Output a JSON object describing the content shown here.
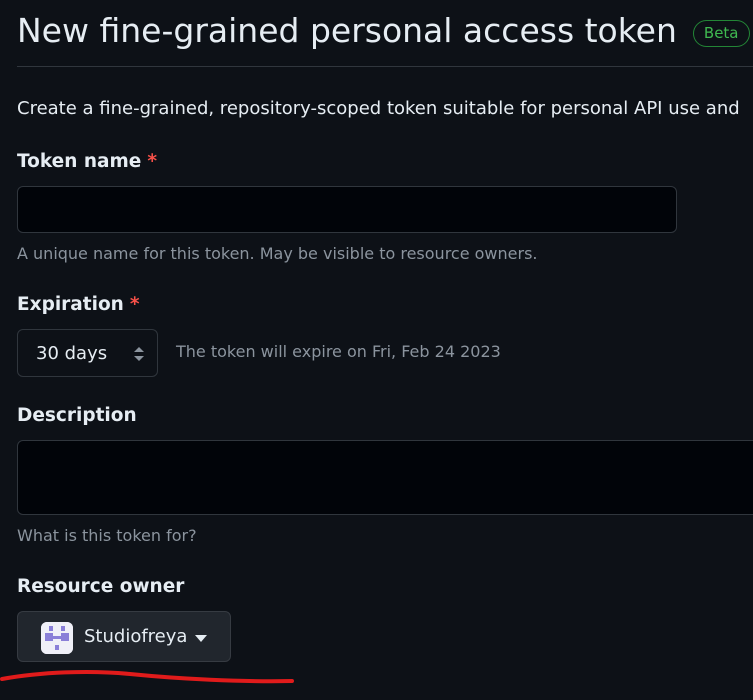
{
  "header": {
    "title": "New fine-grained personal access token",
    "badge": "Beta"
  },
  "intro": {
    "text": "Create a fine-grained, repository-scoped token suitable for personal API use and"
  },
  "token_name": {
    "label": "Token name",
    "required_mark": "*",
    "value": "",
    "hint": "A unique name for this token. May be visible to resource owners."
  },
  "expiration": {
    "label": "Expiration",
    "required_mark": "*",
    "selected": "30 days",
    "note": "The token will expire on Fri, Feb 24 2023"
  },
  "description": {
    "label": "Description",
    "value": "",
    "hint": "What is this token for?"
  },
  "resource_owner": {
    "label": "Resource owner",
    "selected": "Studiofreya",
    "avatar_icon": "org-avatar-icon",
    "caret_icon": "caret-down-icon"
  },
  "colors": {
    "background": "#0d1117",
    "beta_green": "#3fb950",
    "required_red": "#f85149",
    "annotation_red": "#e01b1b",
    "avatar_purple": "#8a7fd8"
  }
}
